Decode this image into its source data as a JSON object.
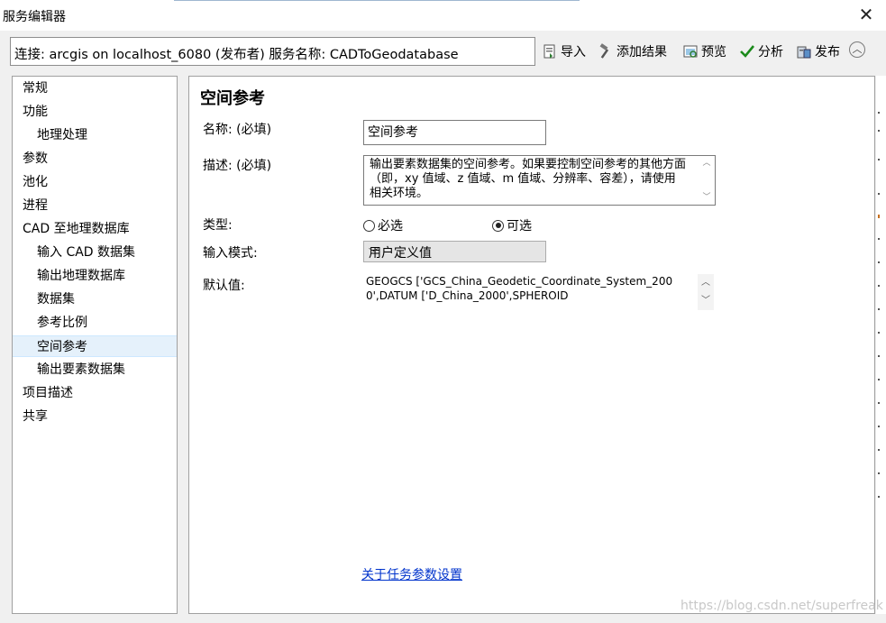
{
  "window": {
    "title": "服务编辑器",
    "close_glyph": "✕"
  },
  "connection": {
    "text": "连接: arcgis on localhost_6080 (发布者)   服务名称: CADToGeodatabase"
  },
  "toolbar": {
    "import": "导入",
    "add_result": "添加结果",
    "preview": "预览",
    "analyze": "分析",
    "publish": "发布",
    "collapse_glyph": "︿"
  },
  "nav": {
    "items": [
      {
        "label": "常规"
      },
      {
        "label": "功能"
      },
      {
        "label": "地理处理"
      },
      {
        "label": "参数"
      },
      {
        "label": "池化"
      },
      {
        "label": "进程"
      },
      {
        "label": "CAD 至地理数据库"
      },
      {
        "label": "输入 CAD 数据集"
      },
      {
        "label": "输出地理数据库"
      },
      {
        "label": "数据集"
      },
      {
        "label": "参考比例"
      },
      {
        "label": "空间参考"
      },
      {
        "label": "输出要素数据集"
      },
      {
        "label": "项目描述"
      },
      {
        "label": "共享"
      }
    ]
  },
  "panel": {
    "heading": "空间参考",
    "name_label": "名称: (必填)",
    "name_value": "空间参考",
    "desc_label": "描述: (必填)",
    "desc_value": "输出要素数据集的空间参考。如果要控制空间参考的其他方面（即，xy 值域、z 值域、m 值域、分辨率、容差），请使用相关环境。",
    "type_label": "类型:",
    "type_required": "必选",
    "type_optional": "可选",
    "mode_label": "输入模式:",
    "mode_value": "用户定义值",
    "default_label": "默认值:",
    "default_value": "GEOGCS ['GCS_China_Geodetic_Coordinate_System_2000',DATUM ['D_China_2000',SPHEROID",
    "help_link": "关于任务参数设置"
  },
  "watermark": "https://blog.csdn.net/superfreak",
  "colors": {
    "selection": "#e5f1fb",
    "link": "#0033cc",
    "window_bg": "#f0f0f0"
  }
}
